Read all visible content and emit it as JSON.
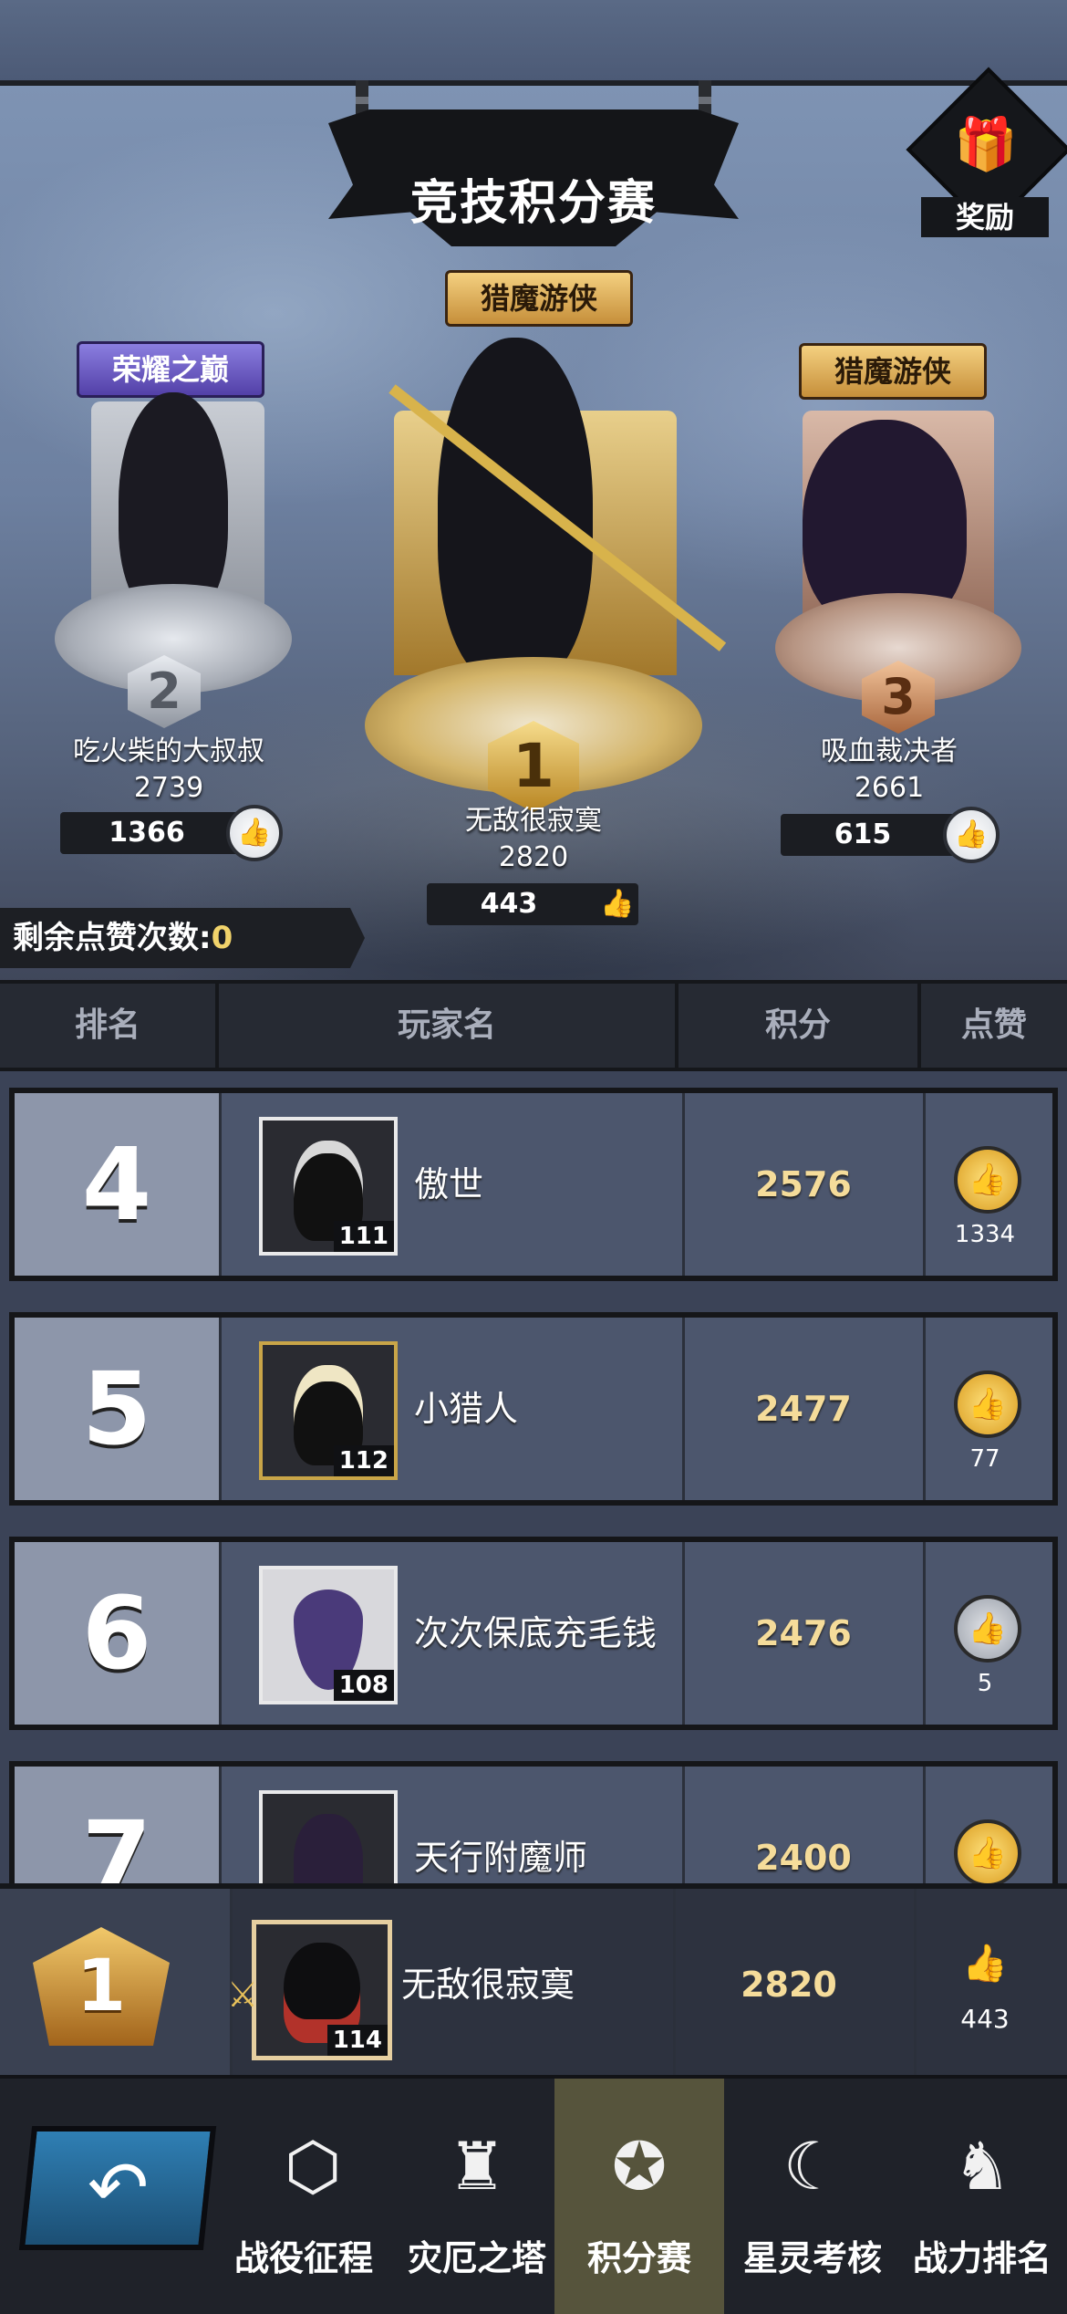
{
  "header": {
    "title": "竞技积分赛",
    "reward_label": "奖励",
    "remaining_likes_label": "剩余点赞次数:",
    "remaining_likes_value": "0"
  },
  "podium": [
    {
      "rank": "2",
      "badge": "荣耀之巅",
      "name": "吃火柴的大叔叔",
      "score": "2739",
      "likes": "1366"
    },
    {
      "rank": "1",
      "badge": "猎魔游侠",
      "name": "无敌很寂寞",
      "score": "2820",
      "likes": "443"
    },
    {
      "rank": "3",
      "badge": "猎魔游侠",
      "name": "吸血裁决者",
      "score": "2661",
      "likes": "615"
    }
  ],
  "table_header": {
    "rank": "排名",
    "player": "玩家名",
    "score": "积分",
    "like": "点赞"
  },
  "rows": [
    {
      "rank": "4",
      "level": "111",
      "name": "傲世",
      "score": "2576",
      "likes": "1334",
      "like_state": "gold"
    },
    {
      "rank": "5",
      "level": "112",
      "name": "小猎人",
      "score": "2477",
      "likes": "77",
      "like_state": "gold"
    },
    {
      "rank": "6",
      "level": "108",
      "name": "次次保底充毛钱",
      "score": "2476",
      "likes": "5",
      "like_state": "grey"
    },
    {
      "rank": "7",
      "level": "",
      "name": "天行附魔师",
      "score": "2400",
      "likes": "",
      "like_state": "gold"
    }
  ],
  "my_rank": {
    "rank": "1",
    "level": "114",
    "name": "无敌很寂寞",
    "score": "2820",
    "likes": "443"
  },
  "nav": {
    "back_icon": "↶",
    "items": [
      {
        "label": "战役征程",
        "icon": "⬡"
      },
      {
        "label": "灾厄之塔",
        "icon": "♜"
      },
      {
        "label": "积分赛",
        "icon": "✪"
      },
      {
        "label": "星灵考核",
        "icon": "☾"
      },
      {
        "label": "战力排名",
        "icon": "♞"
      }
    ]
  },
  "colors": {
    "accent_gold": "#f5dc9a",
    "active_tab": "#56543c"
  }
}
